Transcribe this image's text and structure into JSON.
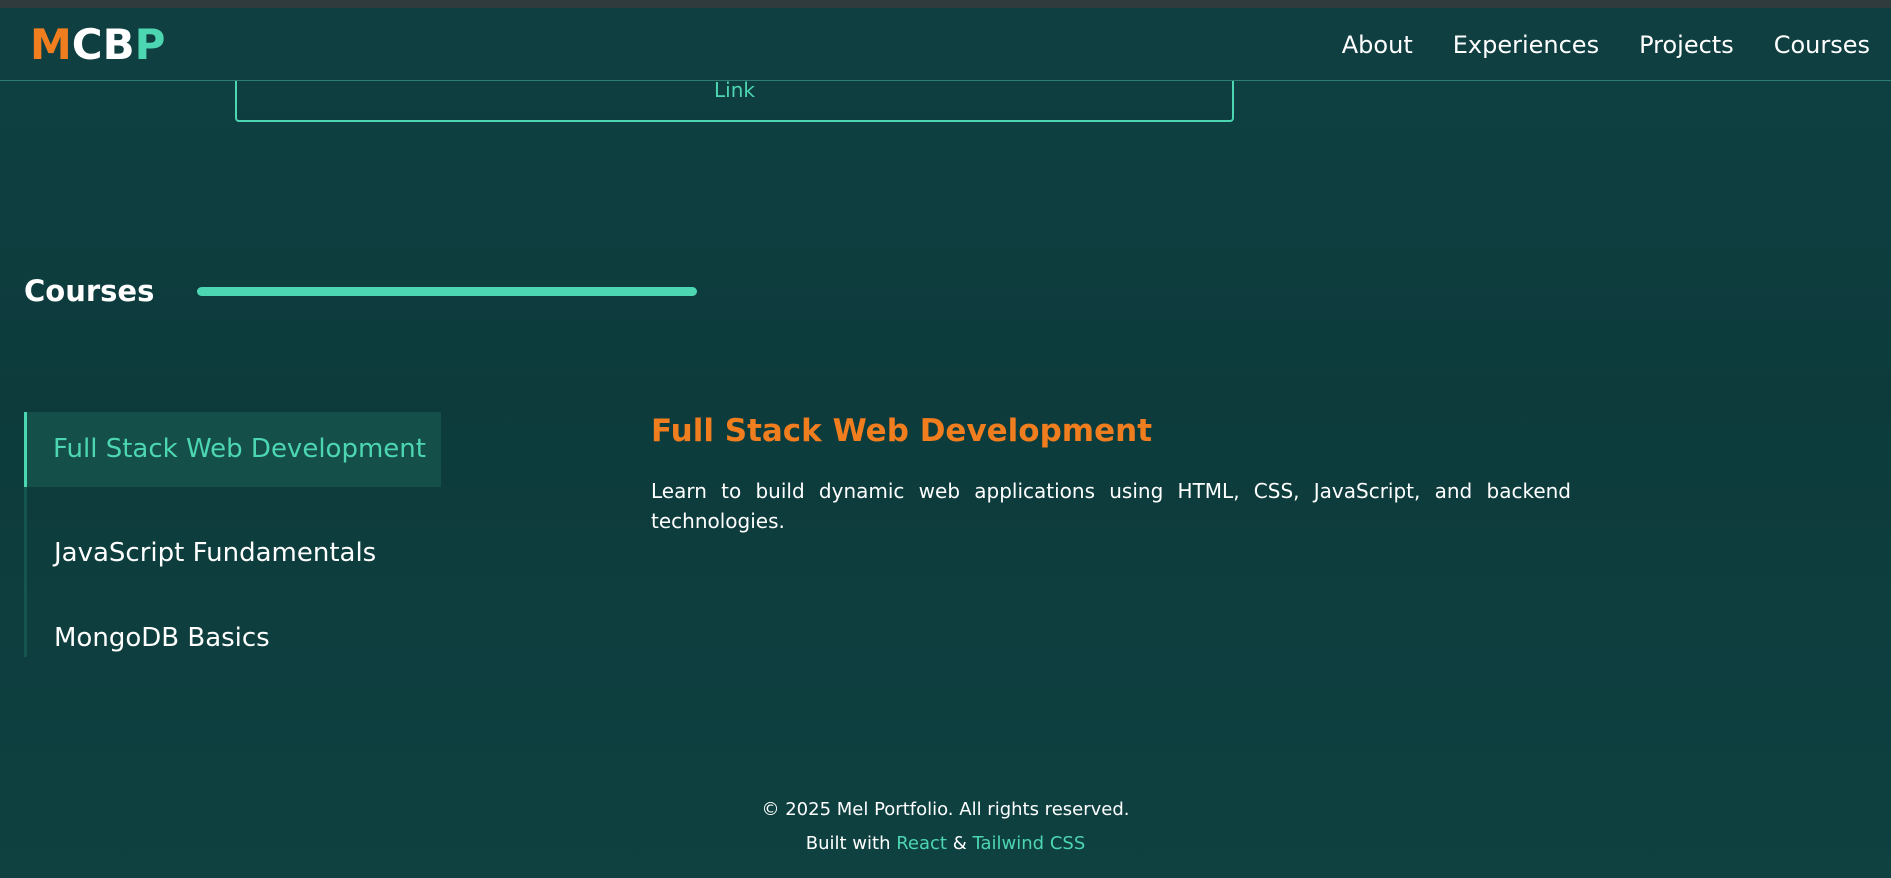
{
  "navbar": {
    "logo": {
      "m": "M",
      "cb": "CB",
      "p": "P"
    },
    "links": [
      "About",
      "Experiences",
      "Projects",
      "Courses"
    ]
  },
  "project_card": {
    "link_label": "Link"
  },
  "courses_section": {
    "title": "Courses",
    "items": [
      {
        "label": "Full Stack Web Development",
        "active": true
      },
      {
        "label": "JavaScript Fundamentals",
        "active": false
      },
      {
        "label": "MongoDB Basics",
        "active": false
      }
    ],
    "detail": {
      "title": "Full Stack Web Development",
      "description": "Learn to build dynamic web applications using HTML, CSS, JavaScript, and backend technologies."
    }
  },
  "footer": {
    "copyright": "© 2025 Mel Portfolio. All rights reserved.",
    "built_with_prefix": "Built with",
    "react_label": "React",
    "ampersand": "&",
    "tailwind_label": "Tailwind CSS"
  },
  "colors": {
    "background": "#0e3d3f",
    "accent_teal": "#4dd6b2",
    "accent_orange": "#f07d1e",
    "text": "#ffffff"
  }
}
